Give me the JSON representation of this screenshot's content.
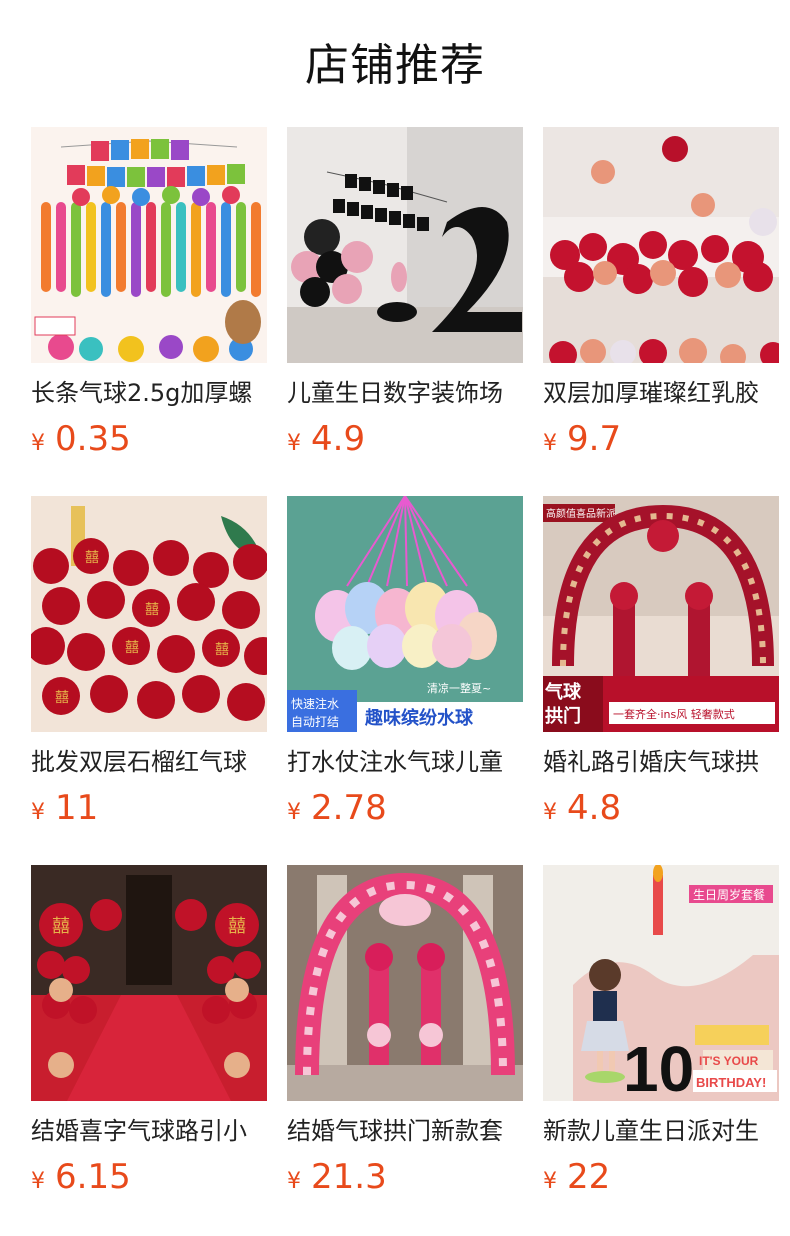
{
  "header": {
    "title": "店铺推荐"
  },
  "products": [
    {
      "name": "长条气球2.5g加厚螺",
      "currency": "¥",
      "price": "0.35",
      "image": {
        "icon": "birthday-balloon-wall-image",
        "banner_text": "HAPPY BIRTHDAY",
        "overlay_text": ""
      }
    },
    {
      "name": "儿童生日数字装饰场",
      "currency": "¥",
      "price": "4.9",
      "image": {
        "icon": "number-balloon-image",
        "banner_text": "HAPPY BIRTHDAY",
        "overlay_text": "2"
      }
    },
    {
      "name": "双层加厚璀璨红乳胶",
      "currency": "¥",
      "price": "9.7",
      "image": {
        "icon": "red-latex-balloons-image",
        "banner_text": "",
        "overlay_text": ""
      }
    },
    {
      "name": "批发双层石榴红气球",
      "currency": "¥",
      "price": "11",
      "image": {
        "icon": "double-happiness-balloons-image",
        "banner_text": "",
        "overlay_text": ""
      }
    },
    {
      "name": "打水仗注水气球儿童",
      "currency": "¥",
      "price": "2.78",
      "image": {
        "icon": "water-balloons-image",
        "banner_text": "快速注水 自动打结",
        "overlay_text": "趣味缤纷水球",
        "sub_text": "清凉一整夏~"
      }
    },
    {
      "name": "婚礼路引婚庆气球拱",
      "currency": "¥",
      "price": "4.8",
      "image": {
        "icon": "wedding-balloon-arch-image",
        "banner_text": "高颜值喜品新派",
        "overlay_text": "气球拱门",
        "sub_text": "一套齐全·ins风 轻奢款式"
      }
    },
    {
      "name": "结婚喜字气球路引小",
      "currency": "¥",
      "price": "6.15",
      "image": {
        "icon": "wedding-aisle-balloons-image",
        "banner_text": "",
        "overlay_text": ""
      }
    },
    {
      "name": "结婚气球拱门新款套",
      "currency": "¥",
      "price": "21.3",
      "image": {
        "icon": "pink-balloon-arch-image",
        "banner_text": "",
        "overlay_text": ""
      }
    },
    {
      "name": "新款儿童生日派对生",
      "currency": "¥",
      "price": "22",
      "image": {
        "icon": "birthday-party-kit-image",
        "banner_text": "生日周岁套餐",
        "overlay_text": "10",
        "sub_text": "IT'S YOUR BIRTHDAY!"
      }
    }
  ],
  "colors": {
    "price": "#e84a1b",
    "title": "#111111"
  }
}
